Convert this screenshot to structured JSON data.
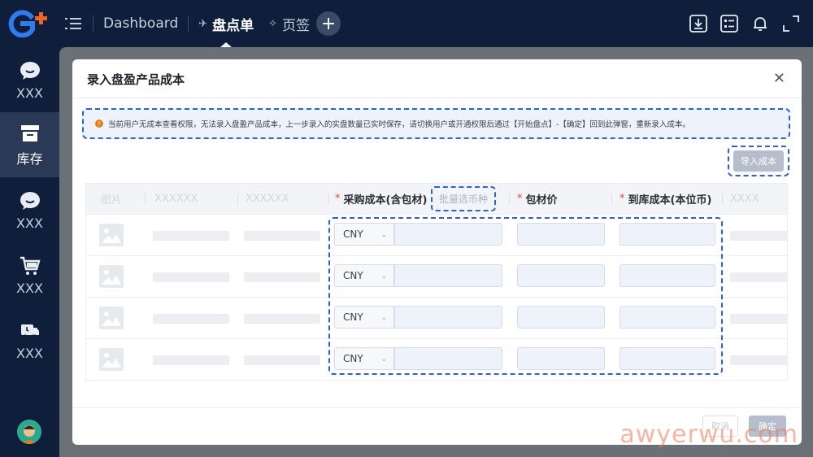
{
  "header": {
    "tabs": [
      {
        "label": "Dashboard"
      },
      {
        "label": "盘点单"
      },
      {
        "label": "页签"
      }
    ]
  },
  "sidebar": {
    "items": [
      {
        "label": "XXX",
        "icon": "chat-icon"
      },
      {
        "label": "库存",
        "icon": "archive-icon"
      },
      {
        "label": "XXX",
        "icon": "chat-icon"
      },
      {
        "label": "XXX",
        "icon": "cart-icon"
      },
      {
        "label": "XXX",
        "icon": "truck-icon"
      }
    ]
  },
  "modal": {
    "title": "录入盘盈产品成本",
    "notice": "当前用户无成本查看权限，无法录入盘盈产品成本，上一步录入的实盘数量已实时保存，请切换用户或开通权限后通过【开始盘点】-【确定】回到此弹窗，重新录入成本。",
    "import_label": "导入成本",
    "batch_label": "批量选币种",
    "columns": {
      "image": "图片",
      "col2": "XXXXXX",
      "col3": "XXXXXX",
      "purchase_cost": "采购成本(含包材)",
      "packaging_price": "包材价",
      "landed_cost": "到库成本(本位币)",
      "col7": "XXXX"
    },
    "rows": [
      {
        "currency": "CNY"
      },
      {
        "currency": "CNY"
      },
      {
        "currency": "CNY"
      },
      {
        "currency": "CNY"
      }
    ],
    "cancel_label": "取消",
    "ok_label": "确定"
  },
  "watermark": "awyerwu.com",
  "colors": {
    "nav_bg": "#0f1e3a",
    "accent_dashed": "#2d63c9",
    "required": "#e8453c",
    "logo_blue": "#2f7bf0",
    "logo_orange": "#f0642a"
  }
}
